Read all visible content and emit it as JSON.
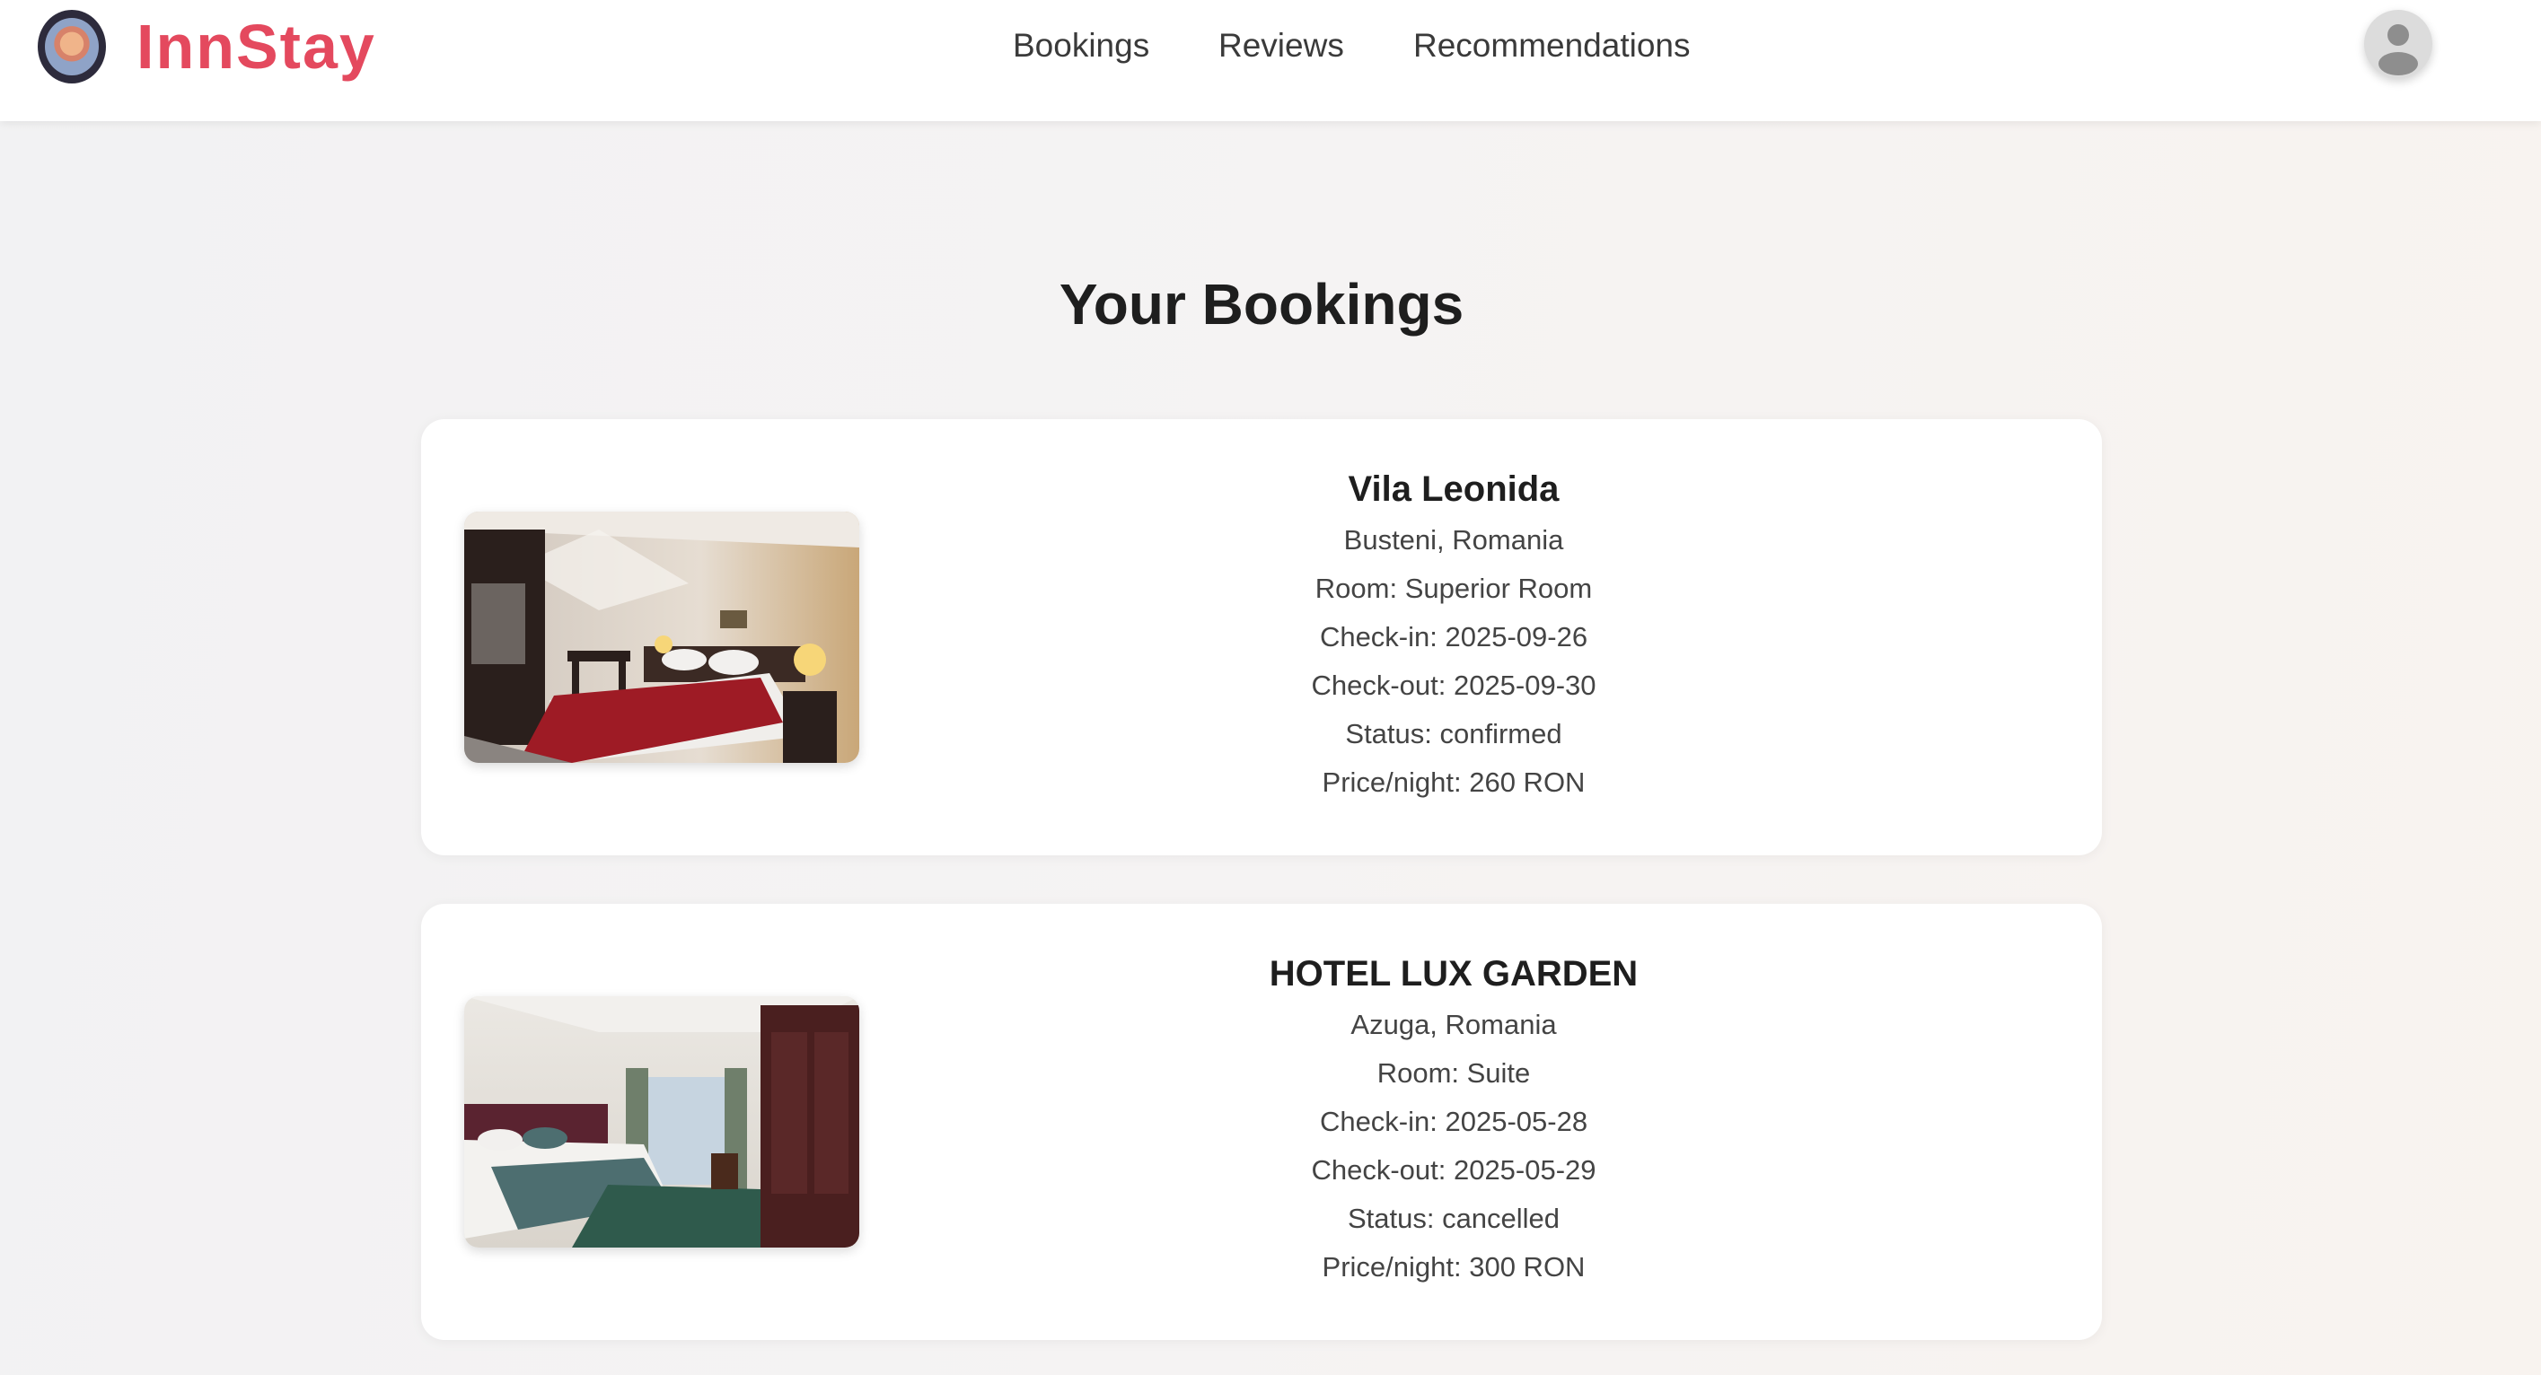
{
  "header": {
    "brand": "InnStay",
    "nav": [
      "Bookings",
      "Reviews",
      "Recommendations"
    ]
  },
  "page": {
    "title": "Your Bookings"
  },
  "bookings": [
    {
      "name": "Vila Leonida",
      "location": "Busteni, Romania",
      "room": "Room: Superior Room",
      "checkin": "Check-in: 2025-09-26",
      "checkout": "Check-out: 2025-09-30",
      "status": "Status: confirmed",
      "price": "Price/night: 260 RON"
    },
    {
      "name": "HOTEL LUX GARDEN",
      "location": "Azuga, Romania",
      "room": "Room: Suite",
      "checkin": "Check-in: 2025-05-28",
      "checkout": "Check-out: 2025-05-29",
      "status": "Status: cancelled",
      "price": "Price/night: 300 RON"
    }
  ],
  "colors": {
    "brand": "#e4495e",
    "text": "#1e1e1e"
  },
  "icons": {
    "logo": "brand-logo-icon",
    "avatar": "user-avatar-icon"
  }
}
